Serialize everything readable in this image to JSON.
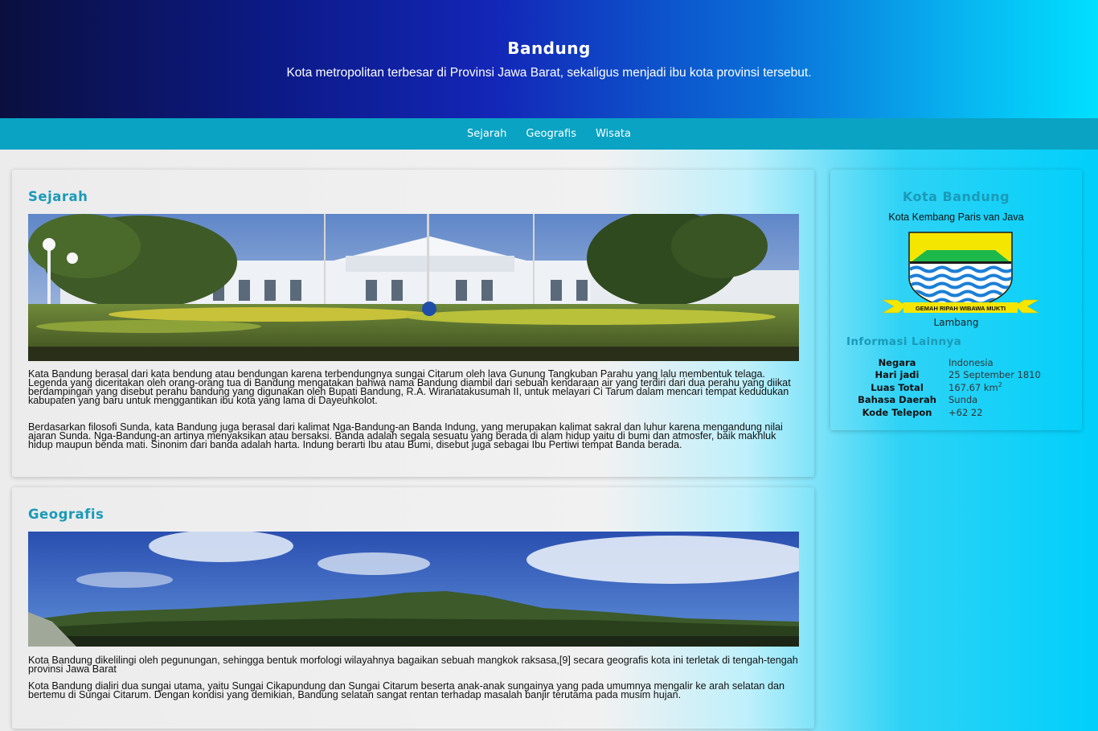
{
  "header": {
    "title": "Bandung",
    "subtitle": "Kota metropolitan terbesar di Provinsi Jawa Barat, sekaligus menjadi ibu kota provinsi tersebut."
  },
  "nav": {
    "items": [
      {
        "label": "Sejarah"
      },
      {
        "label": "Geografis"
      },
      {
        "label": "Wisata"
      }
    ]
  },
  "sections": {
    "sejarah": {
      "heading": "Sejarah",
      "paragraphs": [
        "Kata Bandung berasal dari kata bendung atau bendungan karena terbendungnya sungai Citarum oleh lava Gunung Tangkuban Parahu yang lalu membentuk telaga. Legenda yang diceritakan oleh orang-orang tua di Bandung mengatakan bahwa nama Bandung diambil dari sebuah kendaraan air yang terdiri dari dua perahu yang diikat berdampingan yang disebut perahu bandung yang digunakan oleh Bupati Bandung, R.A. Wiranatakusumah II, untuk melayari Ci Tarum dalam mencari tempat kedudukan kabupaten yang baru untuk menggantikan ibu kota yang lama di Dayeuhkolot.",
        "Berdasarkan filosofi Sunda, kata Bandung juga berasal dari kalimat Nga-Bandung-an Banda Indung, yang merupakan kalimat sakral dan luhur karena mengandung nilai ajaran Sunda. Nga-Bandung-an artinya menyaksikan atau bersaksi. Banda adalah segala sesuatu yang berada di alam hidup yaitu di bumi dan atmosfer, baik makhluk hidup maupun benda mati. Sinonim dari banda adalah harta. Indung berarti Ibu atau Bumi, disebut juga sebagai Ibu Pertiwi tempat Banda berada."
      ]
    },
    "geografis": {
      "heading": "Geografis",
      "paragraphs": [
        "Kota Bandung dikelilingi oleh pegunungan, sehingga bentuk morfologi wilayahnya bagaikan sebuah mangkok raksasa,[9] secara geografis kota ini terletak di tengah-tengah provinsi Jawa Barat",
        "Kota Bandung dialiri dua sungai utama, yaitu Sungai Cikapundung dan Sungai Citarum beserta anak-anak sungainya yang pada umumnya mengalir ke arah selatan dan bertemu di Sungai Citarum. Dengan kondisi yang demikian, Bandung selatan sangat rentan terhadap masalah banjir terutama pada musim hujan."
      ]
    }
  },
  "sidebar": {
    "title": "Kota Bandung",
    "subtitle": "Kota Kembang Paris van Java",
    "emblem_motto": "GEMAH RIPAH WIBAWA MUKTI",
    "emblem_caption": "Lambang",
    "info_heading": "Informasi Lainnya",
    "info": [
      {
        "key": "Negara",
        "value": "Indonesia"
      },
      {
        "key": "Hari jadi",
        "value": "25 September 1810"
      },
      {
        "key": "Luas Total",
        "value": "167.67 km",
        "sup": "2"
      },
      {
        "key": "Bahasa Daerah",
        "value": "Sunda"
      },
      {
        "key": "Kode Telepon",
        "value": "+62 22"
      }
    ]
  },
  "colors": {
    "accent": "#1a9ab8",
    "nav_bg": "#0aa3c4",
    "emblem_yellow": "#f5e600",
    "emblem_green": "#1db84a",
    "emblem_blue": "#1c7fd6"
  }
}
